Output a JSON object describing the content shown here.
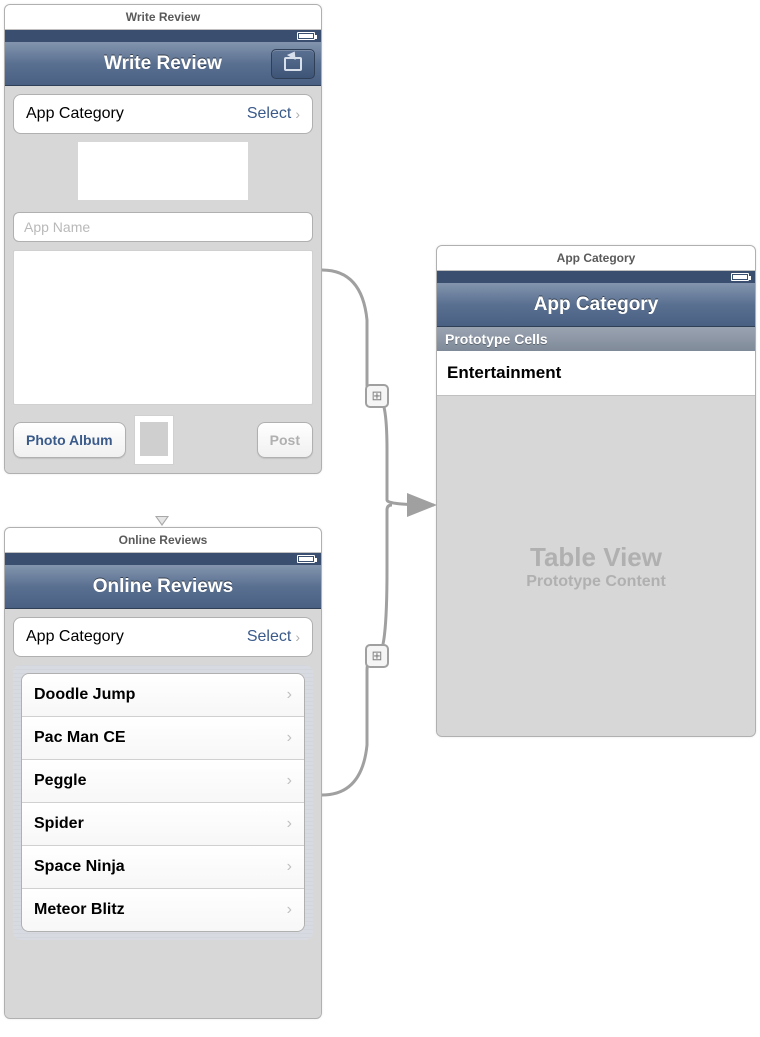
{
  "screen1": {
    "window_title": "Write Review",
    "nav_title": "Write Review",
    "category_row": {
      "label": "App Category",
      "value": "Select"
    },
    "app_name_placeholder": "App Name",
    "photo_button": "Photo Album",
    "post_button": "Post"
  },
  "screen2": {
    "window_title": "Online Reviews",
    "nav_title": "Online Reviews",
    "category_row": {
      "label": "App Category",
      "value": "Select"
    },
    "apps": [
      "Doodle Jump",
      "Pac Man CE",
      "Peggle",
      "Spider",
      "Space Ninja",
      "Meteor Blitz"
    ]
  },
  "screen3": {
    "window_title": "App Category",
    "nav_title": "App Category",
    "section_header": "Prototype Cells",
    "proto_cell": "Entertainment",
    "placeholder_big": "Table View",
    "placeholder_small": "Prototype Content"
  }
}
